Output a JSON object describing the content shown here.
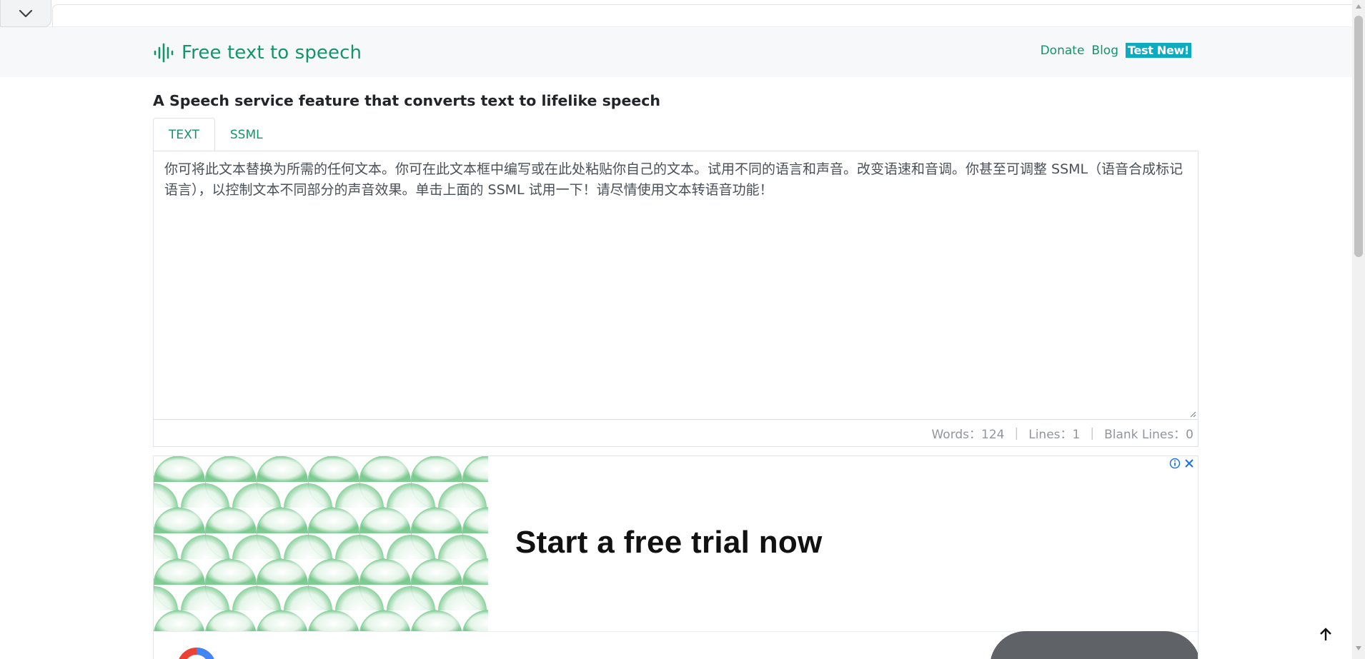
{
  "header": {
    "brand": "Free text to speech",
    "nav": {
      "donate": "Donate",
      "blog": "Blog",
      "test_new": "Test New!"
    }
  },
  "subtitle": "A Speech service feature that converts text to lifelike speech",
  "tabs": [
    {
      "label": "TEXT",
      "active": true
    },
    {
      "label": "SSML",
      "active": false
    }
  ],
  "editor": {
    "value": "你可将此文本替换为所需的任何文本。你可在此文本框中编写或在此处粘贴你自己的文本。试用不同的语言和声音。改变语速和音调。你甚至可调整 SSML（语音合成标记语言），以控制文本不同部分的声音效果。单击上面的 SSML 试用一下！请尽情使用文本转语音功能！"
  },
  "stats": {
    "words": "Words：124",
    "lines": "Lines：1",
    "blank_lines": "Blank Lines：0",
    "separator": "|"
  },
  "ad": {
    "headline": "Start a free trial now",
    "info_icon": "info-icon",
    "close_icon": "close-icon"
  },
  "colors": {
    "brand_green": "#15936a",
    "badge_teal": "#0eaac0",
    "header_bg": "#f7f8f9"
  }
}
